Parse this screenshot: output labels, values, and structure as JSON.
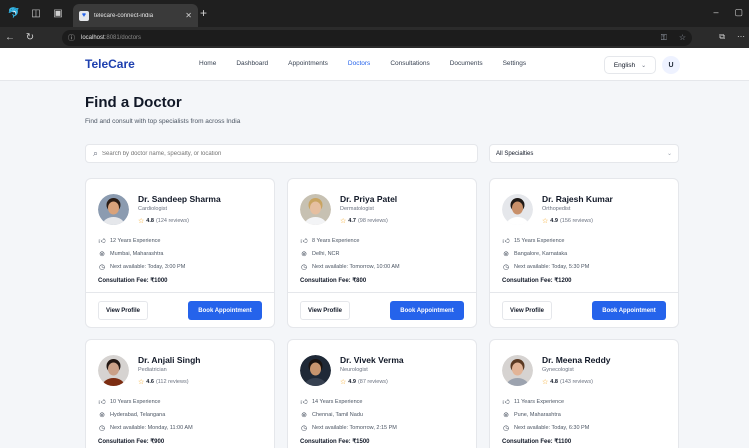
{
  "browser": {
    "tab_title": "telecare-connect-india",
    "url_host": "localhost",
    "url_path": ":8081/doctors"
  },
  "header": {
    "brand": "TeleCare",
    "nav": [
      "Home",
      "Dashboard",
      "Appointments",
      "Doctors",
      "Consultations",
      "Documents",
      "Settings"
    ],
    "active": "Doctors",
    "language": "English",
    "user_initial": "U"
  },
  "page": {
    "title": "Find a Doctor",
    "subtitle": "Find and consult with top specialists from across India",
    "search_placeholder": "Search by doctor name, specialty, or location",
    "specialty_filter": "All Specialties"
  },
  "buttons": {
    "view": "View Profile",
    "book": "Book Appointment"
  },
  "doctors": [
    {
      "name": "Dr. Sandeep Sharma",
      "specialty": "Cardiologist",
      "rating": "4.8",
      "reviews": "(124 reviews)",
      "experience": "12 Years Experience",
      "location": "Mumbai, Maharashtra",
      "availability": "Next available: Today, 3:00 PM",
      "fee": "Consultation Fee: ₹1000"
    },
    {
      "name": "Dr. Priya Patel",
      "specialty": "Dermatologist",
      "rating": "4.7",
      "reviews": "(98 reviews)",
      "experience": "8 Years Experience",
      "location": "Delhi, NCR",
      "availability": "Next available: Tomorrow, 10:00 AM",
      "fee": "Consultation Fee: ₹800"
    },
    {
      "name": "Dr. Rajesh Kumar",
      "specialty": "Orthopedist",
      "rating": "4.9",
      "reviews": "(156 reviews)",
      "experience": "15 Years Experience",
      "location": "Bangalore, Karnataka",
      "availability": "Next available: Today, 5:30 PM",
      "fee": "Consultation Fee: ₹1200"
    },
    {
      "name": "Dr. Anjali Singh",
      "specialty": "Pediatrician",
      "rating": "4.6",
      "reviews": "(112 reviews)",
      "experience": "10 Years Experience",
      "location": "Hyderabad, Telangana",
      "availability": "Next available: Monday, 11:00 AM",
      "fee": "Consultation Fee: ₹900"
    },
    {
      "name": "Dr. Vivek Verma",
      "specialty": "Neurologist",
      "rating": "4.9",
      "reviews": "(87 reviews)",
      "experience": "14 Years Experience",
      "location": "Chennai, Tamil Nadu",
      "availability": "Next available: Tomorrow, 2:15 PM",
      "fee": "Consultation Fee: ₹1500"
    },
    {
      "name": "Dr. Meena Reddy",
      "specialty": "Gynecologist",
      "rating": "4.8",
      "reviews": "(143 reviews)",
      "experience": "11 Years Experience",
      "location": "Pune, Maharashtra",
      "availability": "Next available: Today, 6:30 PM",
      "fee": "Consultation Fee: ₹1100"
    }
  ],
  "colors": {
    "brand": "#1e40af",
    "accent": "#2563eb",
    "star": "#f59e0b"
  }
}
